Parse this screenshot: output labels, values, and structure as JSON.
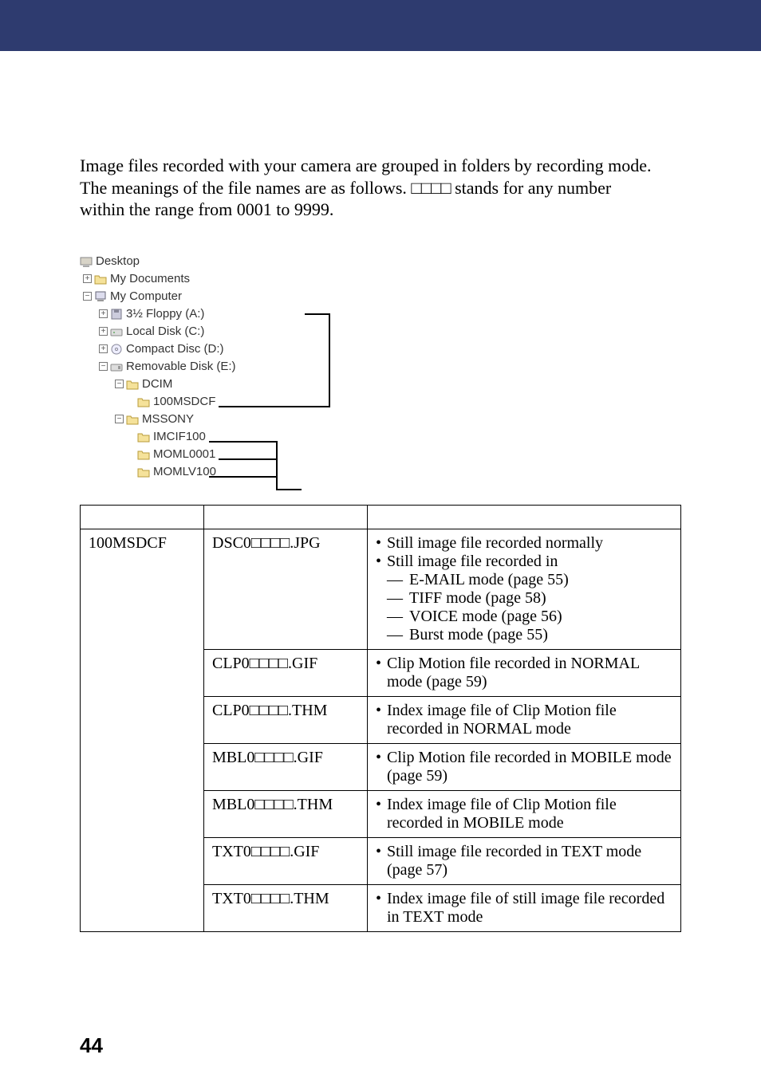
{
  "intro": {
    "line1": "Image files recorded with your camera are grouped in folders by recording mode.",
    "line2a": "The meanings of the file names are as follows. ",
    "squares": "□□□□",
    "line2b": " stands for any number",
    "line3": "within the range from 0001 to 9999."
  },
  "tree": {
    "desktop": "Desktop",
    "mydocs": "My Documents",
    "mycomp": "My Computer",
    "floppy": "3½ Floppy (A:)",
    "local": "Local Disk (C:)",
    "cd": "Compact Disc (D:)",
    "removable": "Removable Disk (E:)",
    "dcim": "DCIM",
    "msdcf": "100MSDCF",
    "mssony": "MSSONY",
    "imcif": "IMCIF100",
    "moml0": "MOML0001",
    "momlv": "MOMLV100"
  },
  "table": {
    "rows": [
      {
        "folder": "100MSDCF",
        "file": "DSC0□□□□.JPG",
        "meaning": [
          {
            "type": "bullet",
            "text": "Still image file recorded normally"
          },
          {
            "type": "bullet",
            "text": "Still image file recorded in"
          },
          {
            "type": "dash",
            "text": "E-MAIL mode (page 55)"
          },
          {
            "type": "dash",
            "text": "TIFF mode (page 58)"
          },
          {
            "type": "dash",
            "text": "VOICE mode (page 56)"
          },
          {
            "type": "dash",
            "text": "Burst mode (page 55)"
          }
        ]
      },
      {
        "folder": "",
        "file": "CLP0□□□□.GIF",
        "meaning": [
          {
            "type": "bullet",
            "text": "Clip Motion file recorded in NORMAL mode (page 59)"
          }
        ]
      },
      {
        "folder": "",
        "file": "CLP0□□□□.THM",
        "meaning": [
          {
            "type": "bullet",
            "text": "Index image file of Clip Motion file recorded in NORMAL mode"
          }
        ]
      },
      {
        "folder": "",
        "file": "MBL0□□□□.GIF",
        "meaning": [
          {
            "type": "bullet",
            "text": "Clip Motion file recorded in MOBILE mode (page 59)"
          }
        ]
      },
      {
        "folder": "",
        "file": "MBL0□□□□.THM",
        "meaning": [
          {
            "type": "bullet",
            "text": "Index image file of Clip Motion file recorded in MOBILE mode"
          }
        ]
      },
      {
        "folder": "",
        "file": "TXT0□□□□.GIF",
        "meaning": [
          {
            "type": "bullet",
            "text": "Still image file recorded in TEXT mode (page 57)"
          }
        ]
      },
      {
        "folder": "",
        "file": "TXT0□□□□.THM",
        "meaning": [
          {
            "type": "bullet",
            "text": "Index image file of still image file recorded in TEXT mode"
          }
        ]
      }
    ]
  },
  "pagenum": "44"
}
